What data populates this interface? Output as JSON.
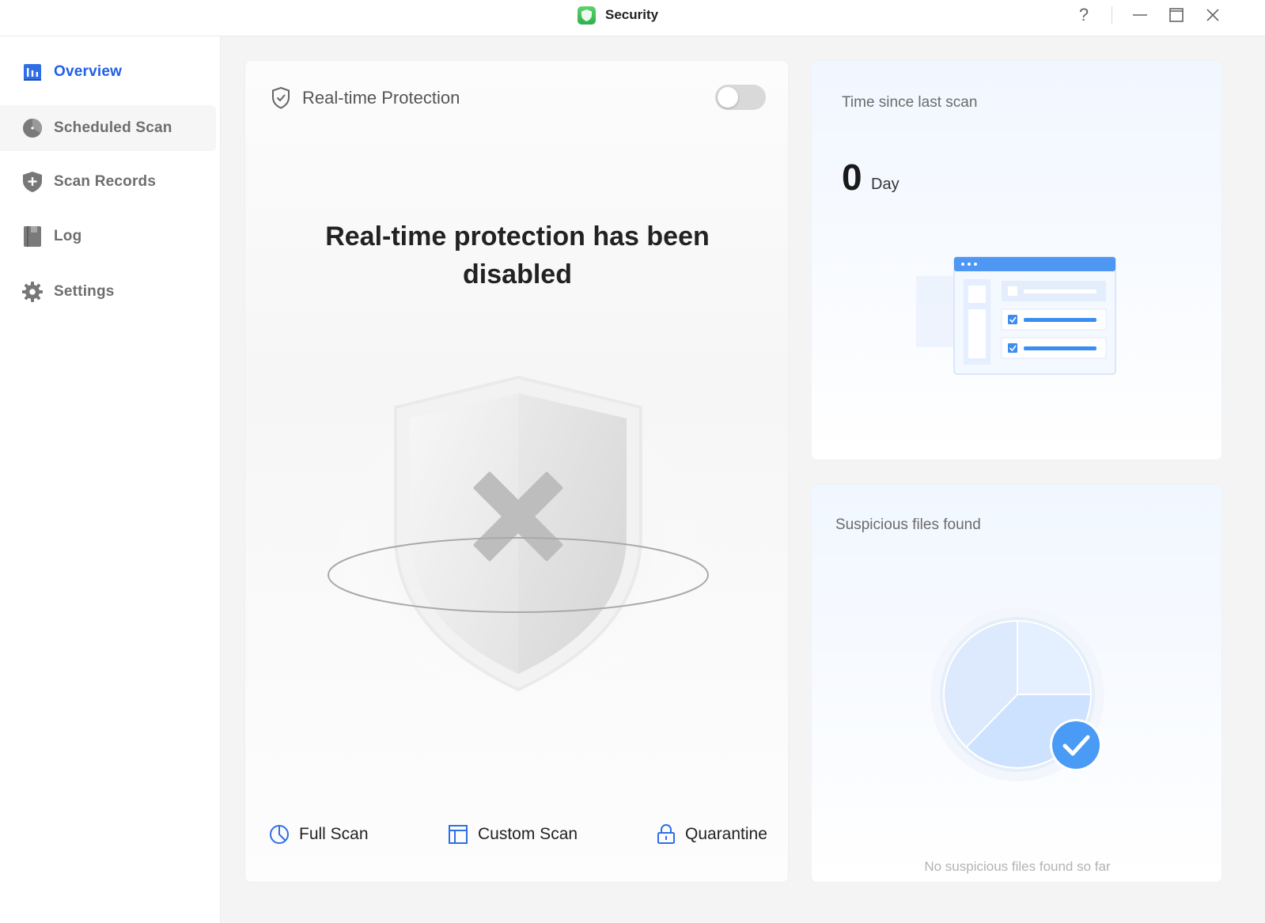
{
  "window": {
    "title": "Security",
    "help_glyph": "?",
    "minimize_glyph": "—",
    "maximize_glyph": "☐",
    "close_glyph": "✕"
  },
  "sidebar": {
    "items": [
      {
        "label": "Overview",
        "icon": "overview-chart-icon",
        "active": true
      },
      {
        "label": "Scheduled Scan",
        "icon": "clock-icon"
      },
      {
        "label": "Scan Records",
        "icon": "shield-plus-icon"
      },
      {
        "label": "Log",
        "icon": "book-icon"
      },
      {
        "label": "Settings",
        "icon": "gear-icon"
      }
    ]
  },
  "protection": {
    "label": "Real-time Protection",
    "enabled": false,
    "status_title": "Real-time protection has been disabled"
  },
  "actions": [
    {
      "label": "Full Scan",
      "icon": "pie-clock-icon"
    },
    {
      "label": "Custom Scan",
      "icon": "layout-icon"
    },
    {
      "label": "Quarantine",
      "icon": "lock-icon"
    }
  ],
  "last_scan": {
    "title": "Time since last scan",
    "value": "0",
    "unit": "Day"
  },
  "suspicious": {
    "title": "Suspicious files found",
    "note": "No suspicious files found so far"
  },
  "colors": {
    "accent": "#1f5fe8",
    "icon_blue": "#2f6fe6",
    "toggle_off": "#d9d9d9",
    "check_blue": "#4a9bf5"
  }
}
